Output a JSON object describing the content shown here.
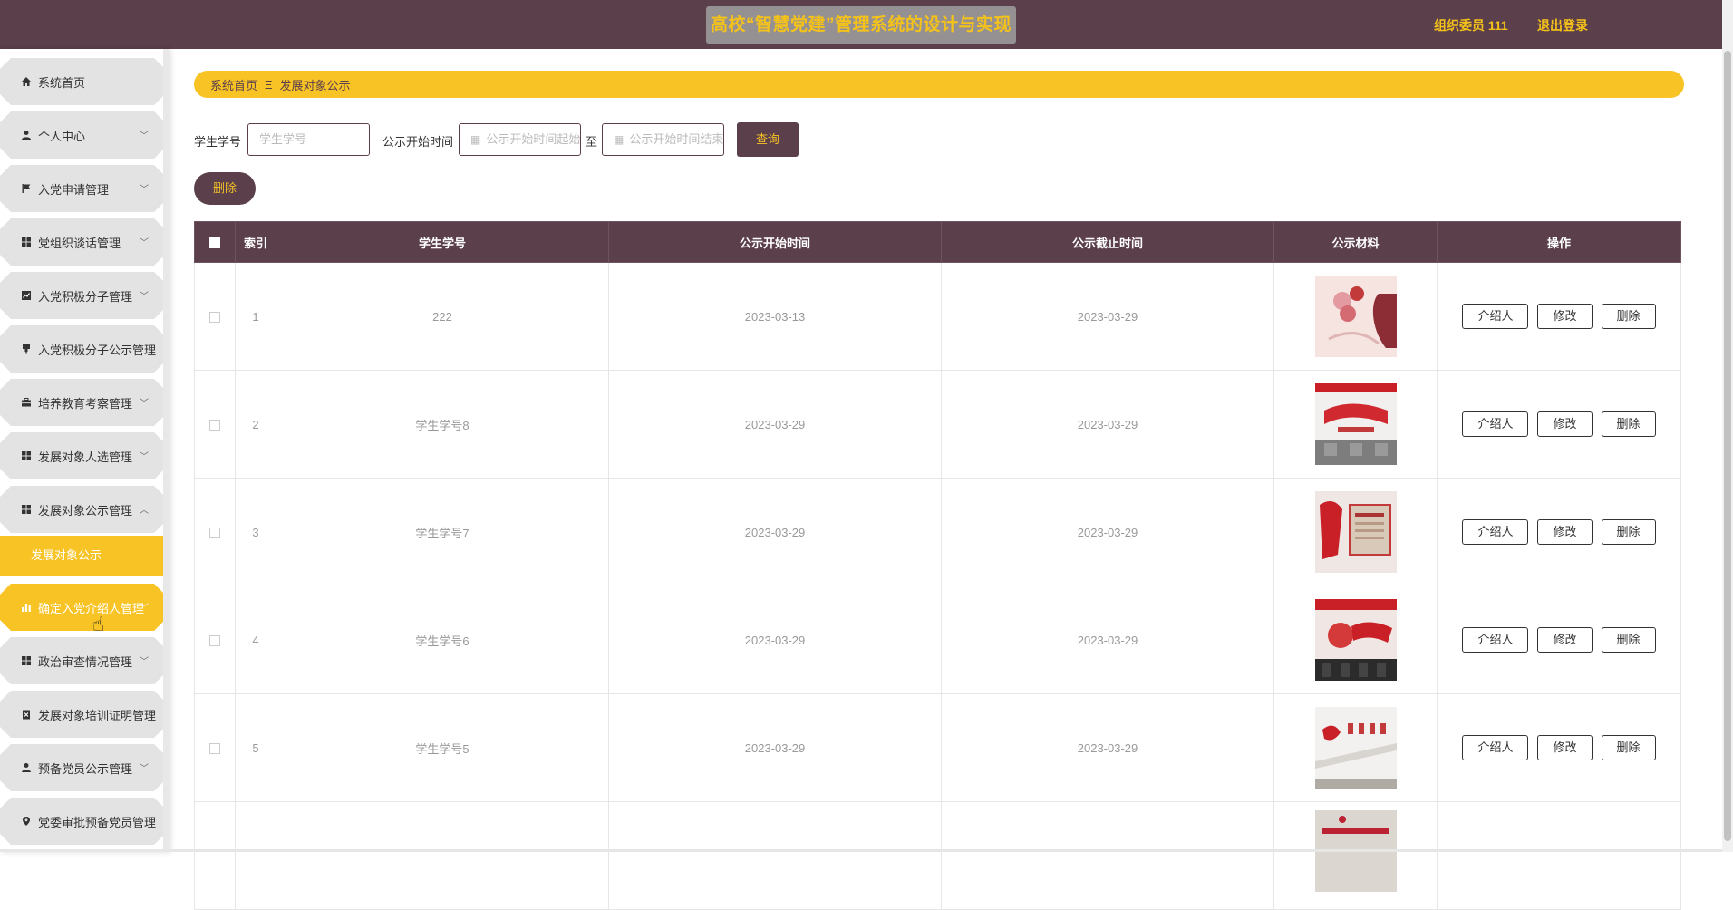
{
  "header": {
    "title": "高校“智慧党建”管理系统的设计与实现",
    "user_label": "组织委员 111",
    "logout_label": "退出登录"
  },
  "sidebar": {
    "items": [
      {
        "label": "系统首页",
        "icon": "home-icon"
      },
      {
        "label": "个人中心",
        "icon": "user-icon"
      },
      {
        "label": "入党申请管理",
        "icon": "flag-icon"
      },
      {
        "label": "党组织谈话管理",
        "icon": "grid-icon"
      },
      {
        "label": "入党积极分子管理",
        "icon": "line-chart-icon"
      },
      {
        "label": "入党积极分子公示管理",
        "icon": "stamp-icon"
      },
      {
        "label": "培养教育考察管理",
        "icon": "briefcase-icon"
      },
      {
        "label": "发展对象人选管理",
        "icon": "grid-icon"
      },
      {
        "label": "发展对象公示管理",
        "icon": "grid-icon"
      },
      {
        "label": "确定入党介绍人管理",
        "icon": "bar-chart-icon"
      },
      {
        "label": "政治审查情况管理",
        "icon": "grid-icon"
      },
      {
        "label": "发展对象培训证明管理",
        "icon": "clipboard-icon"
      },
      {
        "label": "预备党员公示管理",
        "icon": "user-icon"
      },
      {
        "label": "党委审批预备党员管理",
        "icon": "pin-icon"
      }
    ],
    "active_submenu": "发展对象公示"
  },
  "breadcrumb": {
    "home": "系统首页",
    "separator": "Ξ",
    "current": "发展对象公示"
  },
  "search": {
    "student_id_label": "学生学号",
    "student_id_placeholder": "学生学号",
    "time_label": "公示开始时间",
    "start_placeholder": "公示开始时间起始",
    "range_sep": "至",
    "end_placeholder": "公示开始时间结束",
    "query_label": "查询"
  },
  "actions": {
    "delete_label": "删除"
  },
  "table": {
    "columns": [
      "索引",
      "学生学号",
      "公示开始时间",
      "公示截止时间",
      "公示材料",
      "操作"
    ],
    "rows": [
      {
        "index": "1",
        "student_id": "222",
        "start": "2023-03-13",
        "end": "2023-03-29"
      },
      {
        "index": "2",
        "student_id": "学生学号8",
        "start": "2023-03-29",
        "end": "2023-03-29"
      },
      {
        "index": "3",
        "student_id": "学生学号7",
        "start": "2023-03-29",
        "end": "2023-03-29"
      },
      {
        "index": "4",
        "student_id": "学生学号6",
        "start": "2023-03-29",
        "end": "2023-03-29"
      },
      {
        "index": "5",
        "student_id": "学生学号5",
        "start": "2023-03-29",
        "end": "2023-03-29"
      },
      {
        "index": "",
        "student_id": "",
        "start": "",
        "end": ""
      }
    ],
    "op_labels": {
      "introducer": "介绍人",
      "edit": "修改",
      "delete": "删除"
    }
  },
  "colors": {
    "brand": "#5b3f4b",
    "accent": "#f7c325"
  }
}
